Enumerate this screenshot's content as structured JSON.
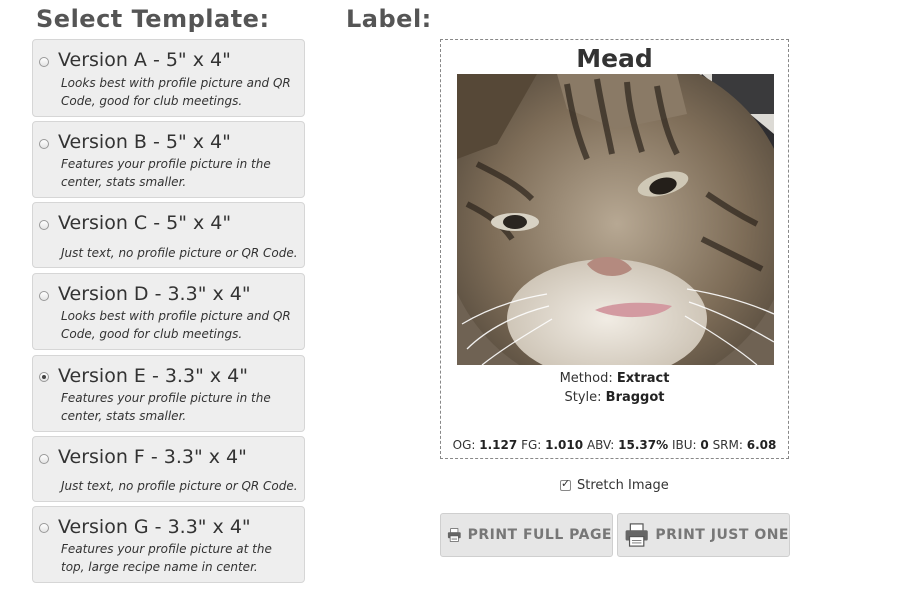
{
  "headings": {
    "left": "Select Template:",
    "right": "Label:"
  },
  "templates": [
    {
      "title": "Version A - 5\" x 4\"",
      "desc": "Looks best with profile picture and QR Code, good for club meetings.",
      "checked": false
    },
    {
      "title": "Version B - 5\" x 4\"",
      "desc": "Features your profile picture in the center, stats smaller.",
      "checked": false
    },
    {
      "title": "Version C - 5\" x 4\"",
      "desc": "Just text, no profile picture or QR Code.",
      "checked": false
    },
    {
      "title": "Version D - 3.3\" x 4\"",
      "desc": "Looks best with profile picture and QR Code, good for club meetings.",
      "checked": false
    },
    {
      "title": "Version E - 3.3\" x 4\"",
      "desc": "Features your profile picture in the center, stats smaller.",
      "checked": true
    },
    {
      "title": "Version F - 3.3\" x 4\"",
      "desc": "Just text, no profile picture or QR Code.",
      "checked": false
    },
    {
      "title": "Version G - 3.3\" x 4\"",
      "desc": "Features your profile picture at the top, large recipe name in center.",
      "checked": false
    }
  ],
  "label": {
    "title": "Mead",
    "method_label": "Method:",
    "method": "Extract",
    "style_label": "Style:",
    "style": "Braggot",
    "stats": {
      "og_label": "OG:",
      "og": "1.127",
      "fg_label": "FG:",
      "fg": "1.010",
      "abv_label": "ABV:",
      "abv": "15.37%",
      "ibu_label": "IBU:",
      "ibu": "0",
      "srm_label": "SRM:",
      "srm": "6.08"
    }
  },
  "stretch_image": {
    "label": "Stretch Image",
    "checked": true
  },
  "buttons": {
    "print_full": "PRINT FULL PAGE",
    "print_one": "PRINT JUST ONE"
  }
}
